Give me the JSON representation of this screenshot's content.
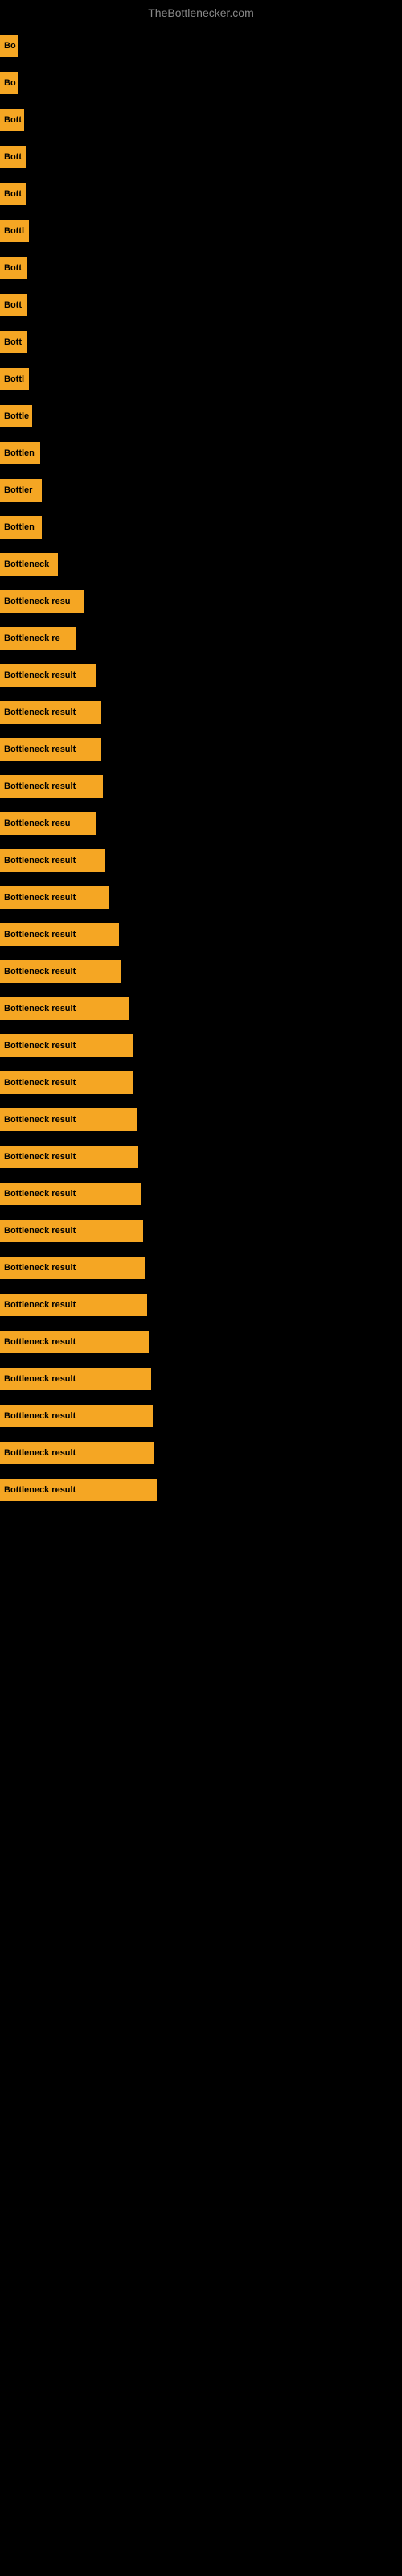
{
  "site_title": "TheBottlenecker.com",
  "bars": [
    {
      "label": "Bo",
      "width": 22
    },
    {
      "label": "Bo",
      "width": 22
    },
    {
      "label": "Bott",
      "width": 30
    },
    {
      "label": "Bott",
      "width": 32
    },
    {
      "label": "Bott",
      "width": 32
    },
    {
      "label": "Bottl",
      "width": 36
    },
    {
      "label": "Bott",
      "width": 34
    },
    {
      "label": "Bott",
      "width": 34
    },
    {
      "label": "Bott",
      "width": 34
    },
    {
      "label": "Bottl",
      "width": 36
    },
    {
      "label": "Bottle",
      "width": 40
    },
    {
      "label": "Bottlen",
      "width": 50
    },
    {
      "label": "Bottler",
      "width": 52
    },
    {
      "label": "Bottlen",
      "width": 52
    },
    {
      "label": "Bottleneck",
      "width": 72
    },
    {
      "label": "Bottleneck resu",
      "width": 105
    },
    {
      "label": "Bottleneck re",
      "width": 95
    },
    {
      "label": "Bottleneck result",
      "width": 120
    },
    {
      "label": "Bottleneck result",
      "width": 125
    },
    {
      "label": "Bottleneck result",
      "width": 125
    },
    {
      "label": "Bottleneck result",
      "width": 128
    },
    {
      "label": "Bottleneck resu",
      "width": 120
    },
    {
      "label": "Bottleneck result",
      "width": 130
    },
    {
      "label": "Bottleneck result",
      "width": 135
    },
    {
      "label": "Bottleneck result",
      "width": 148
    },
    {
      "label": "Bottleneck result",
      "width": 150
    },
    {
      "label": "Bottleneck result",
      "width": 160
    },
    {
      "label": "Bottleneck result",
      "width": 165
    },
    {
      "label": "Bottleneck result",
      "width": 165
    },
    {
      "label": "Bottleneck result",
      "width": 170
    },
    {
      "label": "Bottleneck result",
      "width": 172
    },
    {
      "label": "Bottleneck result",
      "width": 175
    },
    {
      "label": "Bottleneck result",
      "width": 178
    },
    {
      "label": "Bottleneck result",
      "width": 180
    },
    {
      "label": "Bottleneck result",
      "width": 183
    },
    {
      "label": "Bottleneck result",
      "width": 185
    },
    {
      "label": "Bottleneck result",
      "width": 188
    },
    {
      "label": "Bottleneck result",
      "width": 190
    },
    {
      "label": "Bottleneck result",
      "width": 192
    },
    {
      "label": "Bottleneck result",
      "width": 195
    }
  ]
}
